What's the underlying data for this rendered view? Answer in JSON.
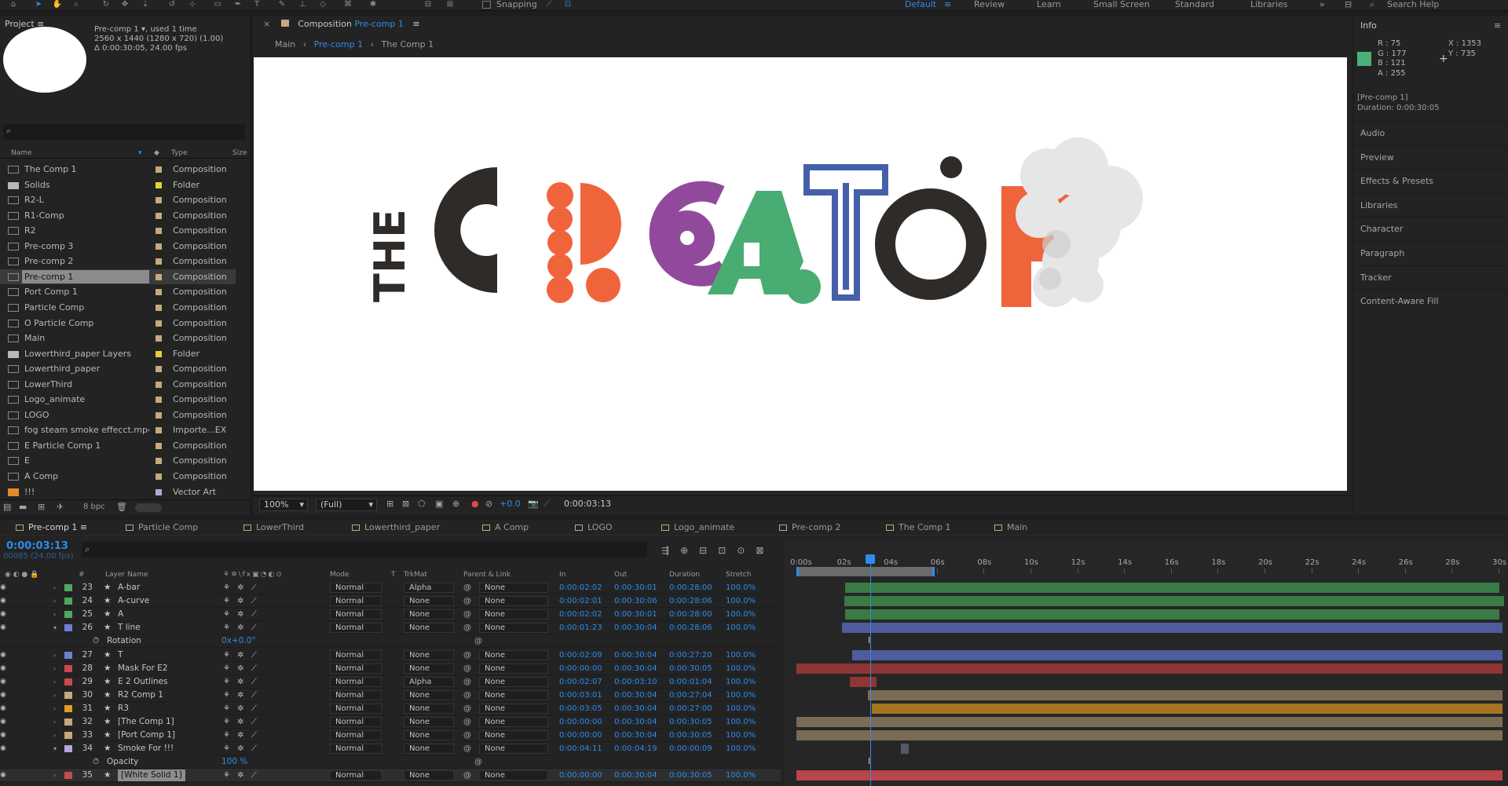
{
  "toolbar": {
    "snapping_label": "Snapping",
    "workspaces": [
      "Default",
      "Review",
      "Learn",
      "Small Screen",
      "Standard",
      "Libraries"
    ],
    "active_workspace": "Default",
    "search_help": "Search Help"
  },
  "project": {
    "title": "Project",
    "selected_name": "Pre-comp 1",
    "used": ", used 1 time",
    "dimensions": "2560 x 1440  (1280 x 720) (1.00)",
    "duration": "Δ 0:00:30:05, 24.00 fps",
    "columns": {
      "name": "Name",
      "type": "Type",
      "size": "Size"
    },
    "items": [
      {
        "name": "The Comp 1",
        "type": "Composition",
        "kind": "comp",
        "color": "#c6a97e"
      },
      {
        "name": "Solids",
        "type": "Folder",
        "kind": "folder",
        "color": "#e5d03c"
      },
      {
        "name": "R2-L",
        "type": "Composition",
        "kind": "comp",
        "color": "#c6a97e"
      },
      {
        "name": "R1-Comp",
        "type": "Composition",
        "kind": "comp",
        "color": "#c6a97e"
      },
      {
        "name": "R2",
        "type": "Composition",
        "kind": "comp",
        "color": "#c6a97e"
      },
      {
        "name": "Pre-comp 3",
        "type": "Composition",
        "kind": "comp",
        "color": "#c6a97e"
      },
      {
        "name": "Pre-comp 2",
        "type": "Composition",
        "kind": "comp",
        "color": "#c6a97e"
      },
      {
        "name": "Pre-comp 1",
        "type": "Composition",
        "kind": "comp",
        "color": "#c6a97e",
        "selected": true
      },
      {
        "name": "Port Comp 1",
        "type": "Composition",
        "kind": "comp",
        "color": "#c6a97e"
      },
      {
        "name": "Particle Comp",
        "type": "Composition",
        "kind": "comp",
        "color": "#c6a97e"
      },
      {
        "name": "O Particle Comp",
        "type": "Composition",
        "kind": "comp",
        "color": "#c6a97e"
      },
      {
        "name": "Main",
        "type": "Composition",
        "kind": "comp",
        "color": "#c6a97e"
      },
      {
        "name": "Lowerthird_paper Layers",
        "type": "Folder",
        "kind": "folder",
        "color": "#e5d03c"
      },
      {
        "name": "Lowerthird_paper",
        "type": "Composition",
        "kind": "comp",
        "color": "#c6a97e"
      },
      {
        "name": "LowerThird",
        "type": "Composition",
        "kind": "comp",
        "color": "#c6a97e"
      },
      {
        "name": "Logo_animate",
        "type": "Composition",
        "kind": "comp",
        "color": "#c6a97e"
      },
      {
        "name": "LOGO",
        "type": "Composition",
        "kind": "comp",
        "color": "#c6a97e"
      },
      {
        "name": "fog steam smoke effecct.mp4",
        "type": "Importe...EX",
        "kind": "file",
        "color": "#c6a97e"
      },
      {
        "name": "E Particle Comp 1",
        "type": "Composition",
        "kind": "comp",
        "color": "#c6a97e"
      },
      {
        "name": "E",
        "type": "Composition",
        "kind": "comp",
        "color": "#c6a97e"
      },
      {
        "name": "A Comp",
        "type": "Composition",
        "kind": "comp",
        "color": "#c6a97e"
      },
      {
        "name": "!!!",
        "type": "Vector Art",
        "kind": "vector",
        "color": "#b5a7d9"
      }
    ],
    "bpc": "8 bpc"
  },
  "composition": {
    "tab_prefix": "Composition",
    "tab_name": "Pre-comp 1",
    "crumbs": [
      "Main",
      "Pre-comp 1",
      "The Comp 1"
    ],
    "zoom": "100%",
    "resolution": "(Full)",
    "exposure": "+0.0",
    "timecode": "0:00:03:13",
    "artwork": {
      "the": "THE",
      "letters": [
        "C",
        "R",
        "E",
        "A",
        "T",
        "O",
        "R"
      ],
      "colors": {
        "dark": "#2e2b29",
        "orange": "#f0643c",
        "purple": "#914a9b",
        "green": "#49ac72",
        "blue": "#4560a8",
        "smoke": "#e6e6e6"
      }
    }
  },
  "info": {
    "title": "Info",
    "r": "R :  75",
    "g": "G :  177",
    "b": "B :  121",
    "a": "A :  255",
    "x": "X : 1353",
    "y": "Y :  735",
    "comp": "[Pre-comp 1]",
    "duration": "Duration: 0:00:30:05"
  },
  "right_panels": [
    "Audio",
    "Preview",
    "Effects & Presets",
    "Libraries",
    "Character",
    "Paragraph",
    "Tracker",
    "Content-Aware Fill"
  ],
  "timeline": {
    "tabs": [
      "Pre-comp 1",
      "Particle Comp",
      "LowerThird",
      "Lowerthird_paper",
      "A Comp",
      "LOGO",
      "Logo_animate",
      "Pre-comp 2",
      "The Comp 1",
      "Main"
    ],
    "active_tab": "Pre-comp 1",
    "current_time": "0:00:03:13",
    "frames": "00085 (24.00 fps)",
    "columns": {
      "hash": "#",
      "layer_name": "Layer Name",
      "mode": "Mode",
      "t": "T",
      "trkmat": "TrkMat",
      "parent": "Parent & Link",
      "in": "In",
      "out": "Out",
      "duration": "Duration",
      "stretch": "Stretch"
    },
    "ruler": [
      "0:00s",
      "02s",
      "04s",
      "06s",
      "08s",
      "10s",
      "12s",
      "14s",
      "16s",
      "18s",
      "20s",
      "22s",
      "24s",
      "26s",
      "28s",
      "30s"
    ],
    "layers": [
      {
        "num": "23",
        "name": "A-bar",
        "mode": "Normal",
        "trk": "Alpha",
        "parent": "None",
        "in": "0:00:02:02",
        "out": "0:00:30:01",
        "dur": "0:00:28:00",
        "str": "100.0%",
        "color": "#4caa5c",
        "bar_color": "#3a7a44",
        "start": 2.08,
        "end": 30.04
      },
      {
        "num": "24",
        "name": "A-curve",
        "mode": "Normal",
        "trk": "None",
        "parent": "None",
        "in": "0:00:02:01",
        "out": "0:00:30:06",
        "dur": "0:00:28:06",
        "str": "100.0%",
        "color": "#4caa5c",
        "bar_color": "#3a7a44",
        "start": 2.04,
        "end": 30.25
      },
      {
        "num": "25",
        "name": "A",
        "mode": "Normal",
        "trk": "None",
        "parent": "None",
        "in": "0:00:02:02",
        "out": "0:00:30:01",
        "dur": "0:00:28:00",
        "str": "100.0%",
        "color": "#4caa5c",
        "bar_color": "#3a7a44",
        "start": 2.08,
        "end": 30.04
      },
      {
        "num": "26",
        "name": "T line",
        "mode": "Normal",
        "trk": "None",
        "parent": "None",
        "in": "0:00:01:23",
        "out": "0:00:30:04",
        "dur": "0:00:28:06",
        "str": "100.0%",
        "color": "#6e7fd6",
        "bar_color": "#4e5c9e",
        "start": 1.96,
        "end": 30.17,
        "sub": {
          "name": "Rotation",
          "value": "0x+0.0°"
        }
      },
      {
        "num": "27",
        "name": "T",
        "mode": "Normal",
        "trk": "None",
        "parent": "None",
        "in": "0:00:02:09",
        "out": "0:00:30:04",
        "dur": "0:00:27:20",
        "str": "100.0%",
        "color": "#6e7fd6",
        "bar_color": "#4e5c9e",
        "start": 2.38,
        "end": 30.17
      },
      {
        "num": "28",
        "name": "Mask For E2",
        "mode": "Normal",
        "trk": "None",
        "parent": "None",
        "in": "0:00:00:00",
        "out": "0:00:30:04",
        "dur": "0:00:30:05",
        "str": "100.0%",
        "color": "#c94a4a",
        "bar_color": "#8e3535",
        "start": 0,
        "end": 30.17
      },
      {
        "num": "29",
        "name": "E 2 Outlines",
        "mode": "Normal",
        "trk": "Alpha",
        "parent": "None",
        "in": "0:00:02:07",
        "out": "0:00:03:10",
        "dur": "0:00:01:04",
        "str": "100.0%",
        "color": "#c94a4a",
        "bar_color": "#8e3535",
        "start": 2.29,
        "end": 3.42
      },
      {
        "num": "30",
        "name": "R2 Comp 1",
        "mode": "Normal",
        "trk": "None",
        "parent": "None",
        "in": "0:00:03:01",
        "out": "0:00:30:04",
        "dur": "0:00:27:04",
        "str": "100.0%",
        "color": "#c6a97e",
        "bar_color": "#7a6b55",
        "start": 3.04,
        "end": 30.17
      },
      {
        "num": "31",
        "name": "R3",
        "mode": "Normal",
        "trk": "None",
        "parent": "None",
        "in": "0:00:03:05",
        "out": "0:00:30:04",
        "dur": "0:00:27:00",
        "str": "100.0%",
        "color": "#e89a2a",
        "bar_color": "#a87420",
        "start": 3.21,
        "end": 30.17
      },
      {
        "num": "32",
        "name": "[The Comp 1]",
        "mode": "Normal",
        "trk": "None",
        "parent": "None",
        "in": "0:00:00:00",
        "out": "0:00:30:04",
        "dur": "0:00:30:05",
        "str": "100.0%",
        "color": "#c6a97e",
        "bar_color": "#7a6b55",
        "start": 0,
        "end": 30.17
      },
      {
        "num": "33",
        "name": "[Port Comp 1]",
        "mode": "Normal",
        "trk": "None",
        "parent": "None",
        "in": "0:00:00:00",
        "out": "0:00:30:04",
        "dur": "0:00:30:05",
        "str": "100.0%",
        "color": "#c6a97e",
        "bar_color": "#7a6b55",
        "start": 0,
        "end": 30.17
      },
      {
        "num": "34",
        "name": "Smoke For !!!",
        "mode": "Normal",
        "trk": "None",
        "parent": "None",
        "in": "0:00:04:11",
        "out": "0:00:04:19",
        "dur": "0:00:00:09",
        "str": "100.0%",
        "color": "#b5a7d9",
        "bar_color": "#58576a",
        "start": 4.46,
        "end": 4.79,
        "sub": {
          "name": "Opacity",
          "value": "100 %"
        }
      },
      {
        "num": "35",
        "name": "[White Solid 1]",
        "mode": "Normal",
        "trk": "None",
        "parent": "None",
        "in": "0:00:00:00",
        "out": "0:00:30:04",
        "dur": "0:00:30:05",
        "str": "100.0%",
        "color": "#c94a4a",
        "bar_color": "#b8454a",
        "start": 0,
        "end": 30.17,
        "selected": true
      }
    ]
  }
}
